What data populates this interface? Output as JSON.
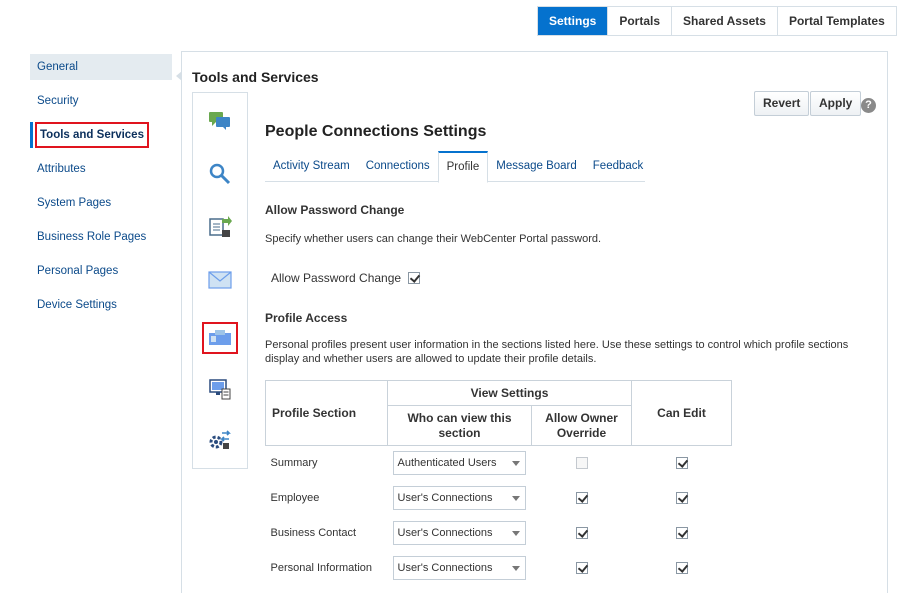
{
  "top_tabs": [
    "Settings",
    "Portals",
    "Shared Assets",
    "Portal Templates"
  ],
  "left_nav": [
    "General",
    "Security",
    "Tools and Services",
    "Attributes",
    "System Pages",
    "Business Role Pages",
    "Personal Pages",
    "Device Settings"
  ],
  "panel": {
    "title": "Tools and Services",
    "revert_label": "Revert",
    "apply_label": "Apply",
    "help_label": "?",
    "heading": "People Connections Settings",
    "sub_tabs": [
      "Activity Stream",
      "Connections",
      "Profile",
      "Message Board",
      "Feedback"
    ],
    "active_sub_tab": "Profile",
    "password": {
      "title": "Allow Password Change",
      "description": "Specify whether users can change their WebCenter Portal password.",
      "checkbox_label": "Allow Password Change",
      "checked": true
    },
    "profile_access": {
      "title": "Profile Access",
      "description_line1": "Personal profiles present user information in the sections listed here. Use these settings to control which profile sections",
      "description_line2": "display and whether users are allowed to update their profile details."
    },
    "table": {
      "col_section": "Profile Section",
      "col_view_settings": "View Settings",
      "col_who_line1": "Who can view this",
      "col_who_line2": "section",
      "col_override_line1": "Allow Owner",
      "col_override_line2": "Override",
      "col_can_edit": "Can Edit",
      "rows": [
        {
          "section": "Summary",
          "who": "Authenticated Users",
          "override": false,
          "override_enabled": false,
          "can_edit": true
        },
        {
          "section": "Employee",
          "who": "User's Connections",
          "override": true,
          "override_enabled": true,
          "can_edit": true
        },
        {
          "section": "Business Contact",
          "who": "User's Connections",
          "override": true,
          "override_enabled": true,
          "can_edit": true
        },
        {
          "section": "Personal Information",
          "who": "User's Connections",
          "override": true,
          "override_enabled": true,
          "can_edit": true
        }
      ]
    }
  },
  "icon_strip": [
    "chat-bubbles-icon",
    "magnifier-icon",
    "document-transfer-icon",
    "envelope-icon",
    "profile-card-icon",
    "desktop-documents-icon",
    "settings-transfer-icon"
  ],
  "colors": {
    "accent": "#0572ce",
    "highlight": "#e0141e",
    "link": "#0b4a8a"
  }
}
